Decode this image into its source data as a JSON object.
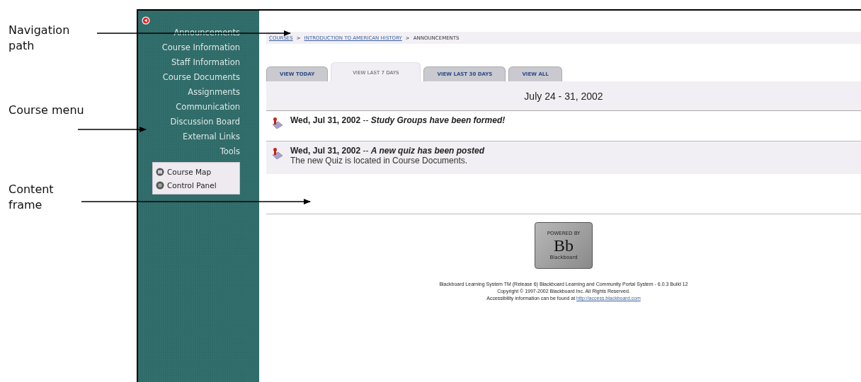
{
  "annotations": [
    {
      "label": "Navigation path"
    },
    {
      "label": "Course menu"
    },
    {
      "label": "Content frame"
    }
  ],
  "course_menu": {
    "items": [
      {
        "label": "Announcements"
      },
      {
        "label": "Course Information"
      },
      {
        "label": "Staff Information"
      },
      {
        "label": "Course Documents"
      },
      {
        "label": "Assignments"
      },
      {
        "label": "Communication"
      },
      {
        "label": "Discussion Board"
      },
      {
        "label": "External Links"
      },
      {
        "label": "Tools"
      }
    ],
    "tools": [
      {
        "label": "Course Map",
        "kind": "map"
      },
      {
        "label": "Control Panel",
        "kind": "panel"
      }
    ]
  },
  "breadcrumb": [
    {
      "label": "COURSES",
      "kind": "link"
    },
    {
      "label": ">",
      "kind": "sep"
    },
    {
      "label": "INTRODUCTION TO AMERICAN HISTORY",
      "kind": "link"
    },
    {
      "label": ">",
      "kind": "sep"
    },
    {
      "label": "ANNOUNCEMENTS",
      "kind": "text"
    }
  ],
  "tabs": [
    {
      "label": "VIEW TODAY",
      "selected": false
    },
    {
      "label": "VIEW LAST 7 DAYS",
      "selected": true
    },
    {
      "label": "VIEW LAST 30 DAYS",
      "selected": false
    },
    {
      "label": "VIEW ALL",
      "selected": false
    }
  ],
  "date_range": "July 24 - 31, 2002",
  "announcements": [
    {
      "date": "Wed, Jul 31, 2002",
      "separator": "--",
      "title": "Study Groups have been formed!"
    },
    {
      "date": "Wed, Jul 31, 2002",
      "separator": "--",
      "title": "A new quiz has been posted",
      "body": "The new Quiz is located in Course Documents."
    }
  ],
  "footer": {
    "logo": {
      "top": "POWERED BY",
      "mark": "Bb",
      "bottom": "Blackboard"
    },
    "lines": [
      {
        "text": "Blackboard Learning System TM (Release 6) Blackboard Learning and Community Portal System - 6.0.3 Build 12"
      },
      {
        "text": "Copyright © 1997-2002 Blackboard Inc. All Rights Reserved."
      },
      {
        "text": "Accessibility information can be found at",
        "link": "http://access.blackboard.com"
      }
    ]
  }
}
